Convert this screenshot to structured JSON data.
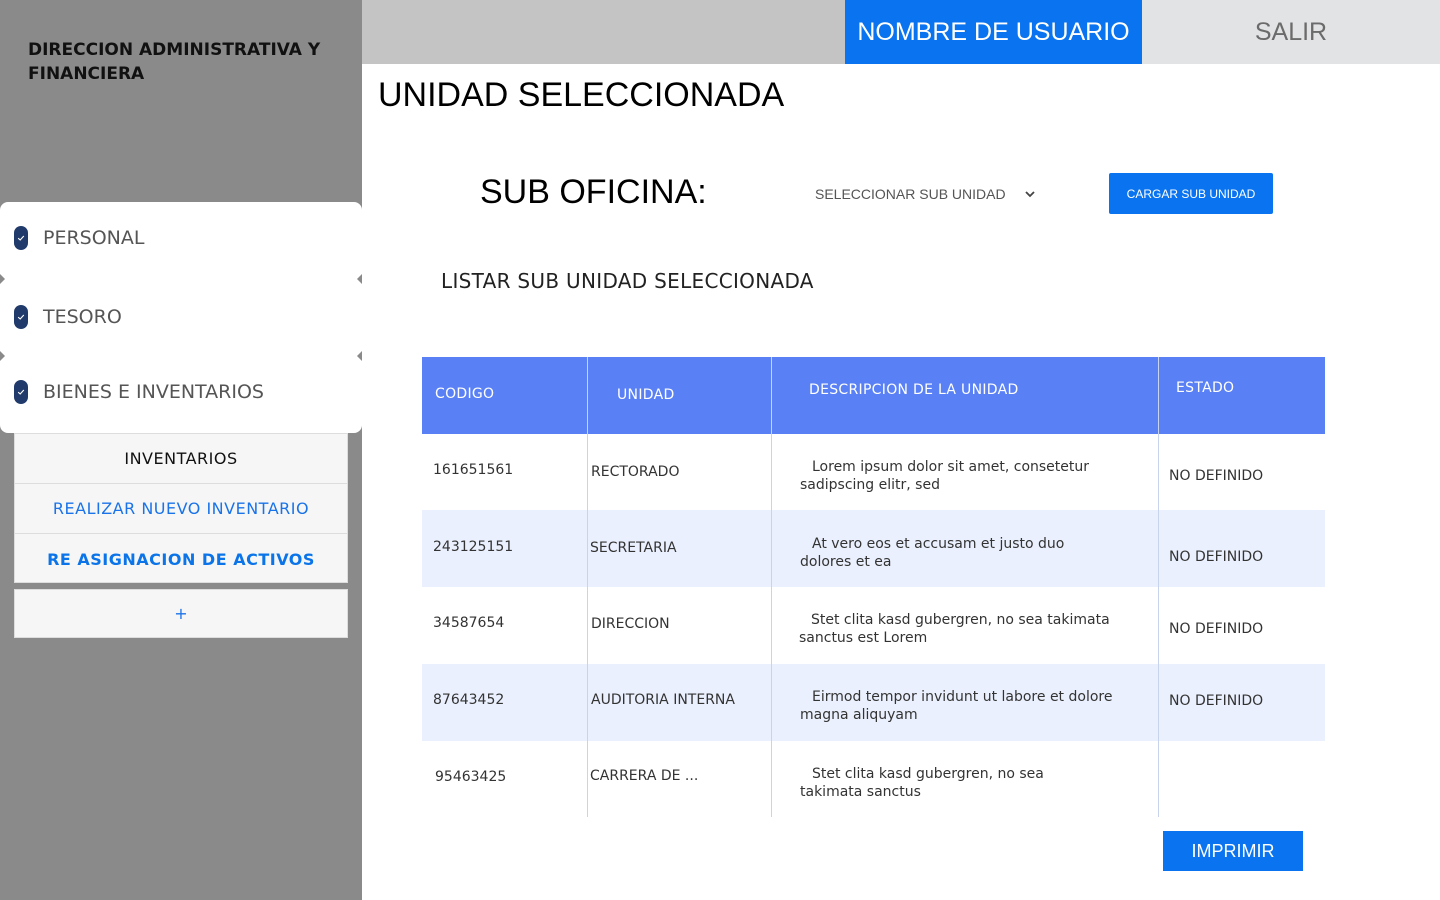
{
  "sidebar": {
    "org_title": "DIRECCION ADMINISTRATIVA Y FINANCIERA",
    "menu": [
      {
        "label": "PERSONAL",
        "icon": "check-circle-icon"
      },
      {
        "label": "TESORO",
        "icon": "check-circle-icon"
      },
      {
        "label": "BIENES E INVENTARIOS",
        "icon": "check-circle-icon"
      }
    ],
    "submenu": {
      "header": "INVENTARIOS",
      "items": [
        "REALIZAR NUEVO INVENTARIO",
        "RE ASIGNACION DE ACTIVOS"
      ]
    },
    "add_label": "+"
  },
  "topbar": {
    "user_label": "NOMBRE DE USUARIO",
    "exit_label": "SALIR"
  },
  "main": {
    "title": "UNIDAD SELECCIONADA",
    "sub_office_label": "SUB OFICINA:",
    "select_value": "SELECCIONAR SUB UNIDAD",
    "load_button": "CARGAR SUB UNIDAD",
    "list_title": "LISTAR SUB UNIDAD SELECCIONADA",
    "print_button": "IMPRIMIR"
  },
  "table": {
    "headers": [
      "CODIGO",
      "UNIDAD",
      "DESCRIPCION DE LA UNIDAD",
      "ESTADO"
    ],
    "rows": [
      {
        "code": "161651561",
        "unit": "RECTORADO",
        "desc_1": "Lorem ipsum dolor sit amet, consetetur",
        "desc_2": "sadipscing elitr, sed",
        "state": "NO DEFINIDO"
      },
      {
        "code": "243125151",
        "unit": "SECRETARIA",
        "desc_1": "At vero eos et accusam et justo duo",
        "desc_2": "dolores et ea",
        "state": "NO DEFINIDO"
      },
      {
        "code": "34587654",
        "unit": "DIRECCION",
        "desc_1": "Stet clita kasd gubergren, no sea takimata",
        "desc_2": "sanctus est Lorem",
        "state": "NO DEFINIDO"
      },
      {
        "code": "87643452",
        "unit": "AUDITORIA INTERNA",
        "desc_1": "Eirmod tempor invidunt ut labore et dolore",
        "desc_2": "magna aliquyam",
        "state": "NO DEFINIDO"
      },
      {
        "code": "95463425",
        "unit": "CARRERA DE ...",
        "desc_1": "Stet clita kasd gubergren, no sea",
        "desc_2": "takimata sanctus",
        "state": ""
      }
    ]
  },
  "colors": {
    "accent": "#0a74f0",
    "table_header": "#5a80f5",
    "row_alt": "#eaf0fd",
    "sidebar_bg": "#8a8a8a"
  }
}
